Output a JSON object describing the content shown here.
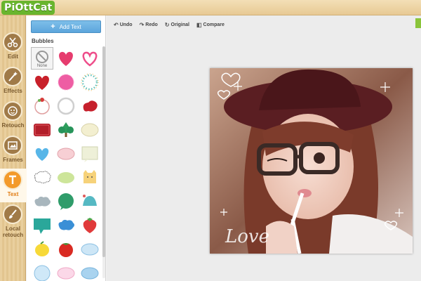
{
  "app": {
    "logo_text": "PiOttCat"
  },
  "nav": {
    "items": [
      {
        "id": "edit",
        "label": "Edit",
        "icon": "scissors-icon"
      },
      {
        "id": "effects",
        "label": "Effects",
        "icon": "magic-wand-icon"
      },
      {
        "id": "retouch",
        "label": "Retouch",
        "icon": "face-icon"
      },
      {
        "id": "frames",
        "label": "Frames",
        "icon": "frame-icon"
      },
      {
        "id": "text",
        "label": "Text",
        "icon": "text-icon",
        "active": true
      },
      {
        "id": "local-retouch",
        "label": "Local retouch",
        "icon": "brush-icon"
      }
    ]
  },
  "panel": {
    "add_text_label": "Add Text",
    "section_title": "Bubbles",
    "none_label": "None",
    "bubbles": [
      "none",
      "heart-red",
      "heart-outline-pink",
      "heart-dark-red",
      "pink-circle",
      "dotted-ring",
      "flower-ring",
      "white-ring",
      "red-splat",
      "red-box",
      "green-tree",
      "cream-cloud",
      "blue-heart",
      "pink-oval",
      "cream-square",
      "dashed-cloud",
      "green-oval",
      "yellow-cat",
      "grey-cloud",
      "green-circle",
      "teal-shell",
      "teal-speech",
      "blue-cloud",
      "strawberry",
      "yellow-lemon",
      "tomato",
      "light-blue-oval",
      "light-blue-circle",
      "pink-oval-light",
      "blue-oval-light"
    ]
  },
  "toolbar": {
    "undo": "Undo",
    "redo": "Redo",
    "original": "Original",
    "compare": "Compare"
  },
  "photo": {
    "overlay_text": "Love"
  },
  "colors": {
    "accent": "#f39a2a",
    "button_blue": "#5ca5dc",
    "brand_green": "#69b52e"
  }
}
